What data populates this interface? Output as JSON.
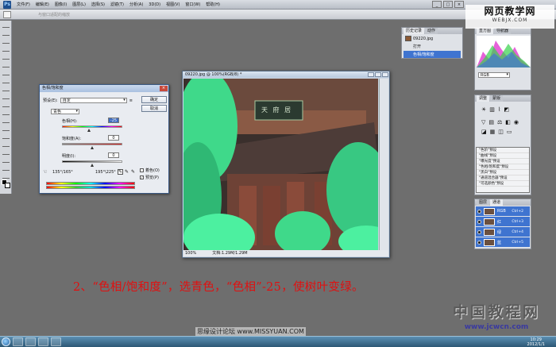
{
  "menubar": {
    "app_icon": "Ps",
    "items": [
      "文件(F)",
      "编辑(E)",
      "图像(I)",
      "图层(L)",
      "选择(S)",
      "滤镜(T)",
      "分析(A)",
      "3D(D)",
      "视图(V)",
      "窗口(W)",
      "帮助(H)"
    ]
  },
  "optbar": {
    "hint": "与窗口适配的缩放"
  },
  "watermark_top": {
    "line1": "网页教学网",
    "line2": "WEBJX.COM"
  },
  "dialog": {
    "title": "色相/饱和度",
    "preset_label": "预设(E):",
    "preset_value": "自定",
    "channel_value": "青色",
    "ok_label": "确定",
    "cancel_label": "取消",
    "hue_label": "色相(H):",
    "hue_value": "-25",
    "sat_label": "饱和度(A):",
    "sat_value": "0",
    "light_label": "明度(I):",
    "light_value": "0",
    "range_left": "135°/165°",
    "range_right": "195°\\225°",
    "colorize_label": "着色(O)",
    "preview_label": "预览(P)"
  },
  "document": {
    "title": "09220.jpg @ 100%(RGB/8) *",
    "zoom": "100%",
    "file_info": "文档:1.29M/1.29M"
  },
  "photo": {
    "sign_text": "天 府 居"
  },
  "history_panel": {
    "tabs": [
      "历史记录",
      "动作"
    ],
    "file": "09220.jpg",
    "items": [
      "打开",
      "色相/饱和度"
    ]
  },
  "histogram_panel": {
    "tabs": [
      "直方图",
      "导航器"
    ],
    "channel": "RGB"
  },
  "adjust_panel": {
    "tabs": [
      "调整",
      "蒙版"
    ],
    "items": [
      "\"色阶\"预设",
      "\"曲线\"预设",
      "\"曝光度\"预设",
      "\"色相/饱和度\"预设",
      "\"黑白\"预设",
      "\"通道混合器\"预设",
      "\"可选颜色\"预设"
    ]
  },
  "layers_panel": {
    "tabs": [
      "图层",
      "通道"
    ],
    "rows": [
      {
        "name": "RGB",
        "shortcut": "Ctrl+2"
      },
      {
        "name": "红",
        "shortcut": "Ctrl+3"
      },
      {
        "name": "绿",
        "shortcut": "Ctrl+4"
      },
      {
        "name": "蓝",
        "shortcut": "Ctrl+5"
      }
    ]
  },
  "caption": "2、“色相/饱和度”，选青色，“色相”-25，使树叶变绿。",
  "watermark_bottom": {
    "line1": "中国教程网",
    "line2": "www.jcwcn.com"
  },
  "watermark_center": "思缘设计论坛  www.MISSYUAN.COM",
  "taskbar": {
    "time": "10:29",
    "date": "2012/1/1"
  },
  "colors": {
    "caption": "#e01010",
    "selection": "#3f74d0",
    "leaf_green": "#3fd98a"
  }
}
